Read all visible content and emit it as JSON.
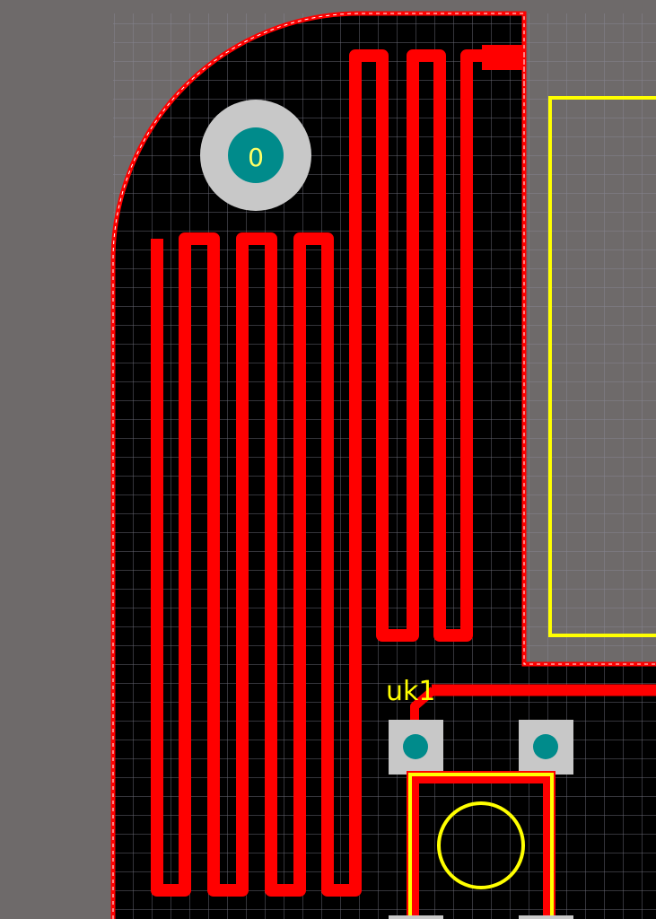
{
  "editor": {
    "colors": {
      "background": "#6e6a6a",
      "grid": "#8c8c9c",
      "board": "#000000",
      "copper": "#ff0000",
      "silkscreen": "#ffff00",
      "pad_outer": "#c8c8c8",
      "pad_hole": "#008b8b",
      "outline_dash": "#ffffff"
    }
  },
  "board": {
    "mounting_hole": {
      "label": "0",
      "icon": "mounting-hole-icon"
    },
    "antenna_trace": {
      "icon": "meander-antenna-trace"
    },
    "component": {
      "designator": "uk1",
      "icon": "tact-switch-footprint-icon"
    },
    "connector_outline": {
      "icon": "connector-silkscreen-outline"
    }
  }
}
